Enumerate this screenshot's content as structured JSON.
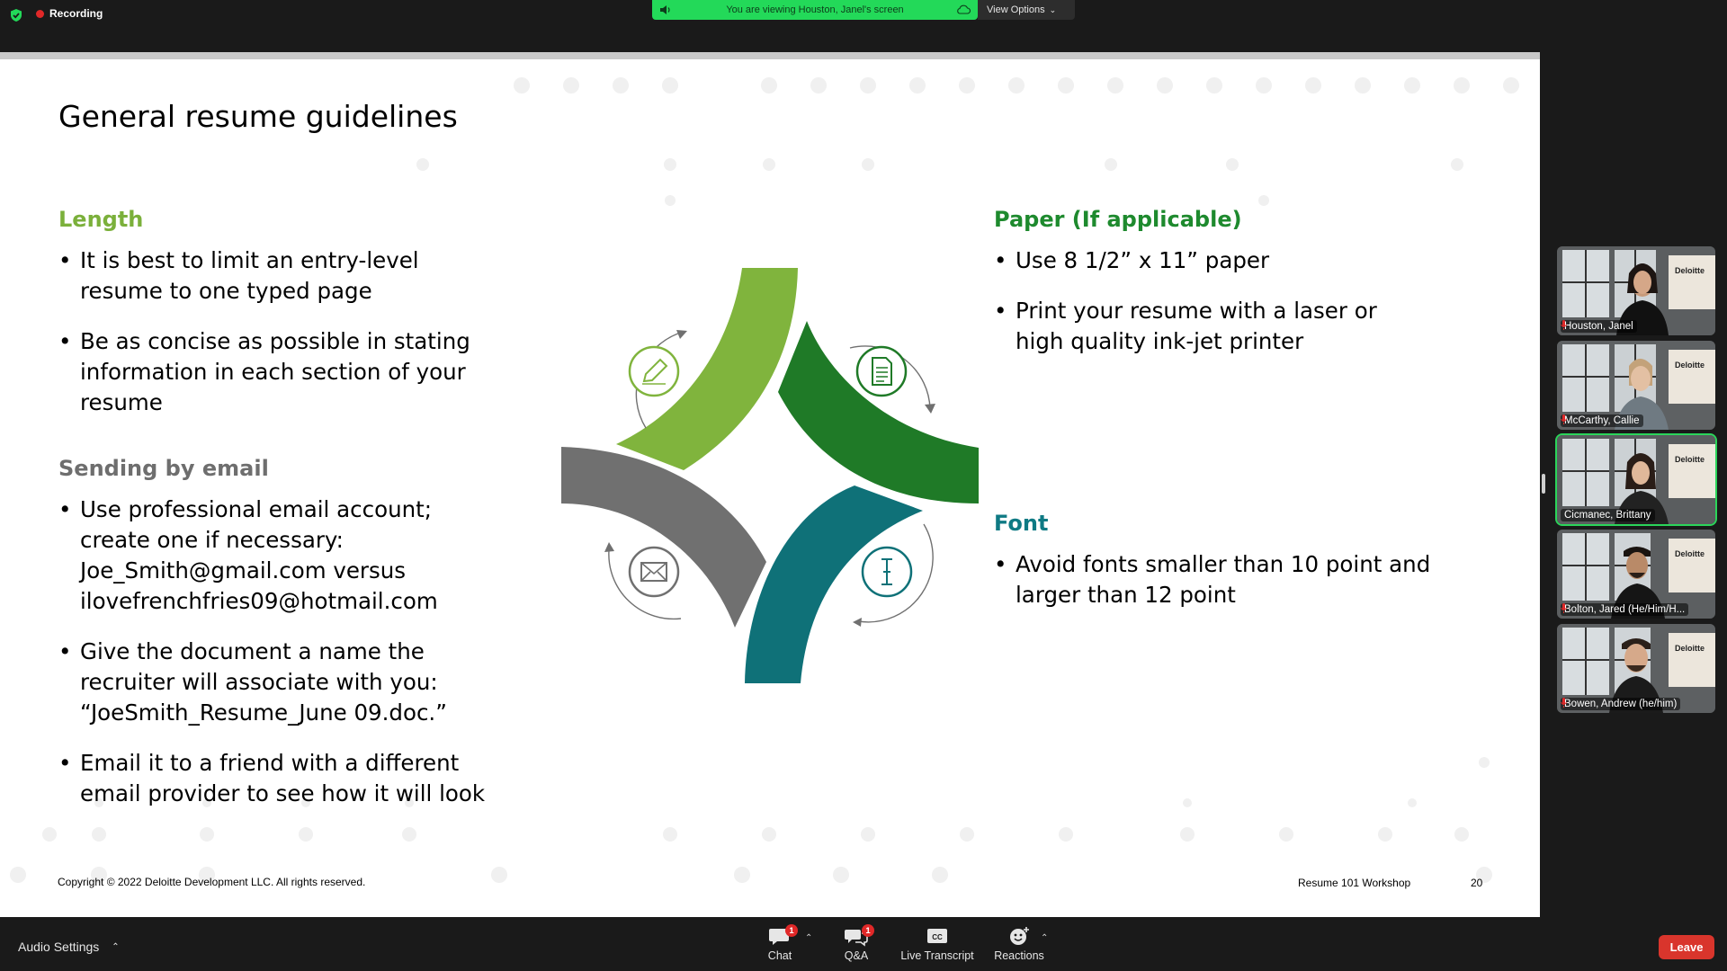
{
  "top_bar": {
    "recording_label": "Recording",
    "viewing_banner": "You are viewing Houston, Janel's screen",
    "view_options_label": "View Options"
  },
  "slide": {
    "title": "General resume guidelines",
    "sections": {
      "length": {
        "heading": "Length",
        "bullets": [
          "It is best to limit an entry-level resume to one typed page",
          "Be as concise as possible in stating information in each section of your resume"
        ]
      },
      "email": {
        "heading": "Sending by email",
        "bullets": [
          "Use professional email account; create one if necessary: Joe_Smith@gmail.com versus ilovefrenchfries09@hotmail.com",
          "Give the document a name the recruiter will associate with you: “JoeSmith_Resume_June 09.doc.”",
          "Email it to a friend with a different email provider to see how it will look"
        ]
      },
      "paper": {
        "heading": "Paper (If applicable)",
        "bullets": [
          "Use 8 1/2” x 11” paper",
          "Print your resume with a laser or high quality ink-jet printer"
        ]
      },
      "font": {
        "heading": "Font",
        "bullets": [
          "Avoid fonts smaller than 10 point and larger than 12 point"
        ]
      }
    },
    "diagram_icons": [
      "pencil-icon",
      "document-icon",
      "envelope-icon",
      "text-cursor-icon"
    ],
    "footer": {
      "copyright": "Copyright © 2022 Deloitte Development LLC. All rights reserved.",
      "workshop": "Resume 101 Workshop",
      "page_number": "20"
    }
  },
  "participants": [
    {
      "name": "Houston, Janel",
      "active": false
    },
    {
      "name": "McCarthy, Callie",
      "active": false
    },
    {
      "name": "Cicmanec, Brittany",
      "active": true
    },
    {
      "name": "Bolton, Jared (He/Him/H...",
      "active": false
    },
    {
      "name": "Bowen, Andrew (he/him)",
      "active": false
    }
  ],
  "toolbar": {
    "audio_settings": "Audio Settings",
    "chat": {
      "label": "Chat",
      "badge": "1"
    },
    "qa": {
      "label": "Q&A",
      "badge": "1"
    },
    "live_transcript": {
      "label": "Live Transcript",
      "icon_text": "CC"
    },
    "reactions": {
      "label": "Reactions"
    },
    "leave": "Leave"
  },
  "colors": {
    "banner_green": "#23d959",
    "heading_light_green": "#7bb03b",
    "heading_dark_green": "#1e8a2e",
    "heading_teal": "#0f7a84",
    "heading_gray": "#6e6e6e",
    "shape_light_green": "#80b43d",
    "shape_dark_green": "#1f7a27",
    "shape_gray": "#707070",
    "shape_teal": "#0f7178",
    "leave_red": "#d9352c"
  }
}
